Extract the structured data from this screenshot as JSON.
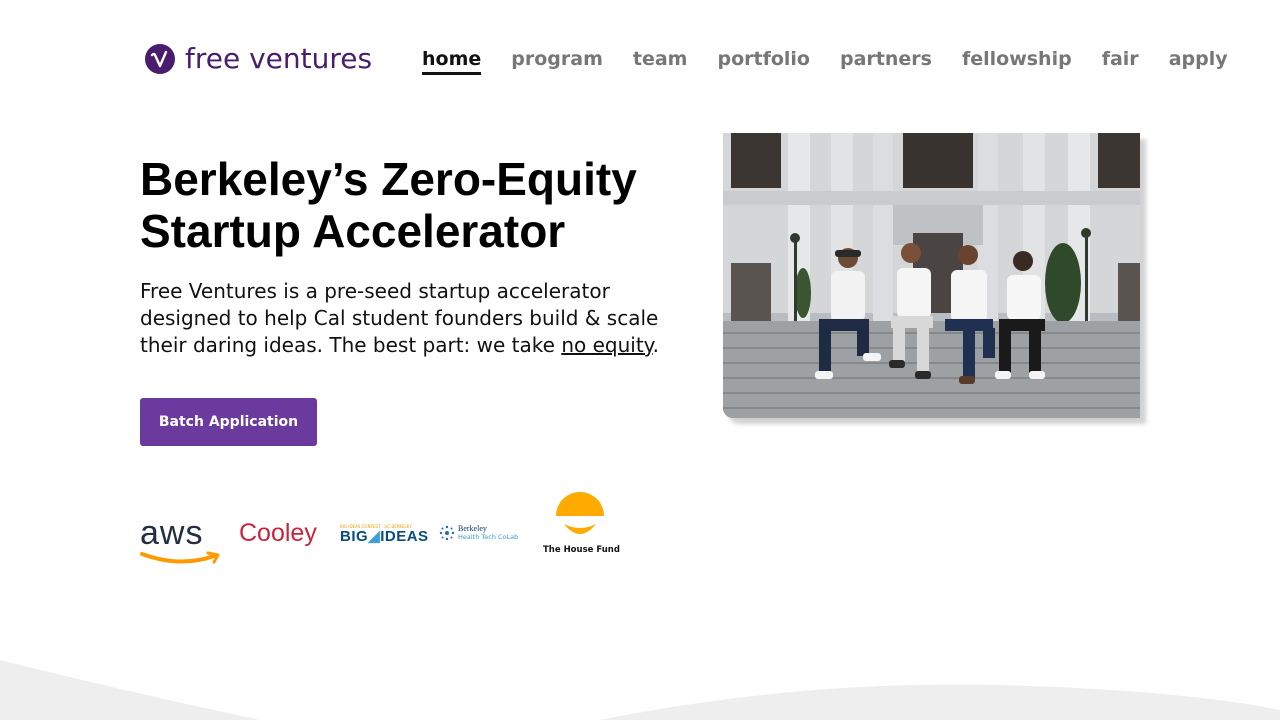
{
  "brand": {
    "name": "free ventures",
    "color": "#4a1c6e"
  },
  "nav": {
    "items": [
      {
        "label": "home",
        "active": true
      },
      {
        "label": "program",
        "active": false
      },
      {
        "label": "team",
        "active": false
      },
      {
        "label": "portfolio",
        "active": false
      },
      {
        "label": "partners",
        "active": false
      },
      {
        "label": "fellowship",
        "active": false
      },
      {
        "label": "fair",
        "active": false
      },
      {
        "label": "apply",
        "active": false
      }
    ]
  },
  "hero": {
    "headline_line1": "Berkeley’s Zero-Equity",
    "headline_line2": "Startup Accelerator",
    "lead_text": "Free Ventures is a pre-seed startup accelerator designed to help Cal student founders build & scale their daring ideas. The best part: we take ",
    "lead_link": "no equity",
    "lead_end": ".",
    "cta_label": "Batch Application",
    "cta_color": "#6a3a9e",
    "photo_icon": "team-photo-image"
  },
  "sponsors": {
    "aws": "aws",
    "cooley": "Cooley",
    "bigideas_small": "BIG IDEAS CONTEST · UC BERKELEY",
    "bigideas_a": "BIG",
    "bigideas_b": "IDEAS",
    "health_line1": "Berkeley",
    "health_line2": "Health Tech CoLab",
    "house_fund": "The House Fund"
  }
}
